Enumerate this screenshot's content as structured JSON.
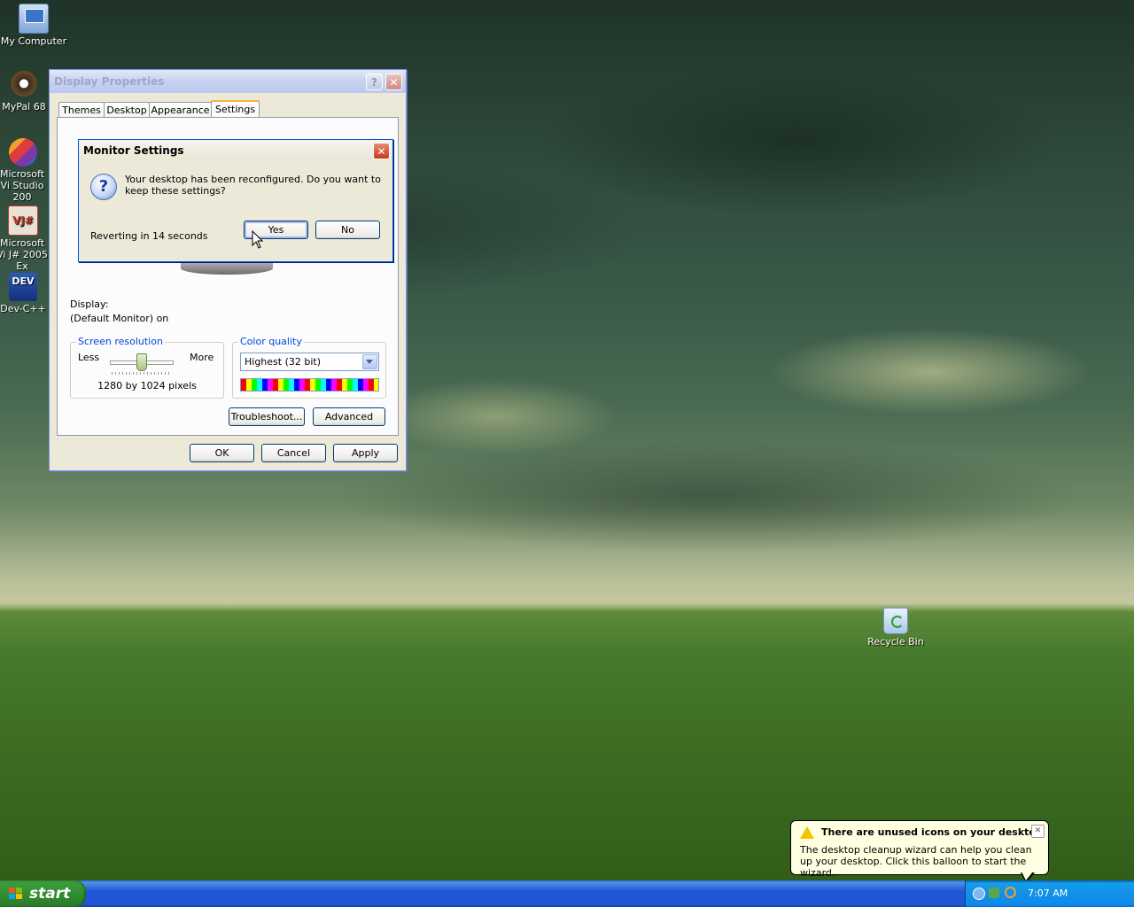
{
  "desktop": {
    "icons": [
      {
        "label": "My Computer"
      },
      {
        "label": "MyPal 68"
      },
      {
        "label": "Microsoft Vi Studio 200"
      },
      {
        "label": "Microsoft Vi J# 2005 Ex"
      },
      {
        "label": "Dev-C++"
      },
      {
        "label": "Recycle Bin"
      }
    ]
  },
  "display_properties": {
    "title": "Display Properties",
    "help_glyph": "?",
    "close_glyph": "✕",
    "tabs": [
      {
        "label": "Themes"
      },
      {
        "label": "Desktop"
      },
      {
        "label": "Appearance"
      },
      {
        "label": "Settings"
      }
    ],
    "display_label": "Display:",
    "display_value": "(Default Monitor) on",
    "screen_resolution": {
      "title": "Screen resolution",
      "less": "Less",
      "more": "More",
      "value_text": "1280 by 1024 pixels",
      "slider_level": 0.5
    },
    "color_quality": {
      "title": "Color quality",
      "selected": "Highest (32 bit)"
    },
    "troubleshoot_label": "Troubleshoot...",
    "advanced_label": "Advanced",
    "ok_label": "OK",
    "cancel_label": "Cancel",
    "apply_label": "Apply"
  },
  "monitor_settings": {
    "title": "Monitor Settings",
    "message": "Your desktop has been reconfigured.  Do you want to keep these settings?",
    "reverting": "Reverting in 14 seconds",
    "yes_label": "Yes",
    "no_label": "No",
    "close_glyph": "✕"
  },
  "taskbar": {
    "start_label": "start",
    "clock": "7:07 AM"
  },
  "balloon": {
    "title": "There are unused icons on your desktop",
    "body": "The desktop cleanup wizard can help you clean up your desktop. Click this balloon to start the wizard.",
    "close_glyph": "✕"
  },
  "colors": {
    "accent_tab": "#fbb13b",
    "groupbox_title": "#0046d5",
    "taskbar_blue": "#2157d7",
    "start_green": "#3a9b3a"
  }
}
